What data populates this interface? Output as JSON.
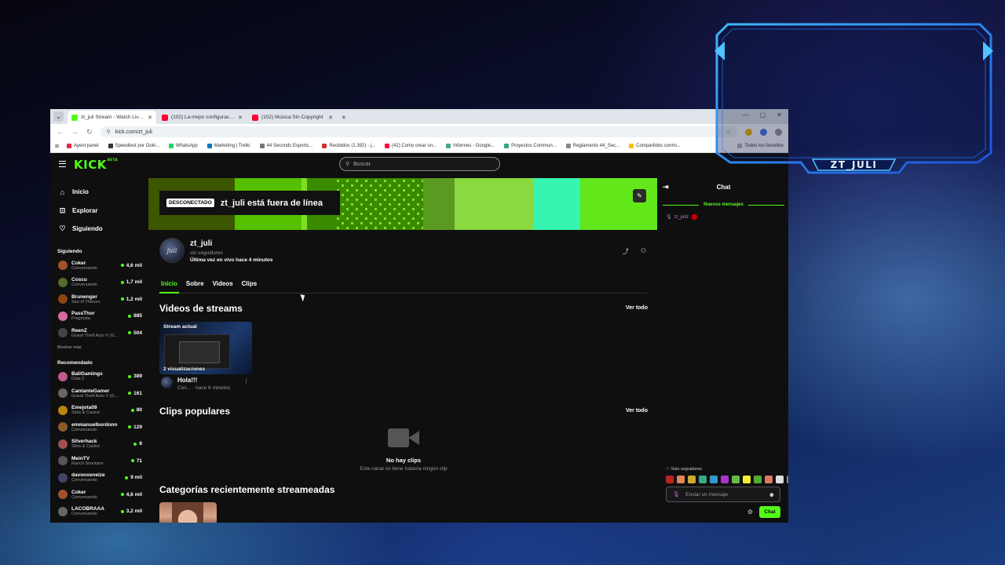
{
  "browser": {
    "tabs": [
      {
        "title": "zt_juli Stream - Watch Live on Kick",
        "icon_color": "#53fc18",
        "active": true
      },
      {
        "title": "(102) La mejor configuración de OBS",
        "icon_color": "#ff0033",
        "active": false
      },
      {
        "title": "(102) Música Sin Copyright",
        "icon_color": "#ff0033",
        "active": false
      }
    ],
    "url": "kick.com/zt_juli",
    "bookmarks": [
      "Ayent panel",
      "Speedtest por Ookl...",
      "WhatsApp",
      "Marketing | Trello",
      "44 Seconds Esports...",
      "Recibidos (1.392) - j...",
      "(42) Como crear un...",
      "Informes - Google...",
      "Proyectos Commun...",
      "Reglamento 44_Sec...",
      "Compartidos conmi..."
    ],
    "other_bookmarks": "Todos los favoritos"
  },
  "kick": {
    "logo": "KICK",
    "logo_sup": "BETA",
    "search_placeholder": "Buscar",
    "nav": [
      {
        "label": "Inicio",
        "icon": "home-icon",
        "glyph": "⌂"
      },
      {
        "label": "Explorar",
        "icon": "compass-icon",
        "glyph": "⊡"
      },
      {
        "label": "Siguiendo",
        "icon": "heart-icon",
        "glyph": "♡"
      }
    ],
    "following_title": "Siguiendo",
    "following": [
      {
        "name": "Coker",
        "category": "Conversando",
        "viewers": "4,6 mil",
        "color": "#a0522d"
      },
      {
        "name": "Coscu",
        "category": "Conversando",
        "viewers": "1,7 mil",
        "color": "#556b2f"
      },
      {
        "name": "Brunenger",
        "category": "Sea of Thieves",
        "viewers": "1,2 mil",
        "color": "#8b4513"
      },
      {
        "name": "PassThor",
        "category": "Pragmata",
        "viewers": "885",
        "color": "#d46aa0"
      },
      {
        "name": "ReenZ",
        "category": "Grand Theft Auto V (G...",
        "viewers": "504",
        "color": "#444444"
      }
    ],
    "show_more": "Mostrar más",
    "recommended_title": "Recomendado",
    "recommended": [
      {
        "name": "BaliGamings",
        "category": "Dota 2",
        "viewers": "389",
        "color": "#c05a8f"
      },
      {
        "name": "CantanteGamer",
        "category": "Grand Theft Auto V (G...",
        "viewers": "161",
        "color": "#666666"
      },
      {
        "name": "Emejota09",
        "category": "Slots & Casino",
        "viewers": "80",
        "color": "#b8860b"
      },
      {
        "name": "emmanuelbordonn",
        "category": "Conversando",
        "viewers": "129",
        "color": "#8b5a2b"
      },
      {
        "name": "Silverhack",
        "category": "Slots & Casino",
        "viewers": "8",
        "color": "#a05050"
      },
      {
        "name": "MeinTV",
        "category": "Ranch Simulator",
        "viewers": "71",
        "color": "#555555"
      },
      {
        "name": "davooxeneize",
        "category": "Conversando",
        "viewers": "9 mil",
        "color": "#444466"
      },
      {
        "name": "Coker",
        "category": "Conversando",
        "viewers": "4,6 mil",
        "color": "#a0522d"
      },
      {
        "name": "LACOBRAAA",
        "category": "Conversando",
        "viewers": "3,2 mil",
        "color": "#666666"
      }
    ],
    "banner": {
      "status_pill": "DESCONECTADO",
      "status_text": "zt_juli está fuera de línea"
    },
    "profile": {
      "name": "zt_juli",
      "followers": "sin seguidores",
      "last_live": "Última vez en vivo hace 4 minutos",
      "avatar_text": "juli"
    },
    "tabs": [
      "Inicio",
      "Sobre",
      "Videos",
      "Clips"
    ],
    "videos_section": {
      "title": "Videos de streams",
      "see_all": "Ver todo",
      "video": {
        "label": "Stream actual",
        "views": "2 visualizaciones",
        "title": "Hola!!!",
        "meta": "Con... · hace 6 minutos"
      }
    },
    "clips_section": {
      "title": "Clips populares",
      "see_all": "Ver todo",
      "empty_title": "No hay clips",
      "empty_sub": "Este canal no tiene todavía ningún clip"
    },
    "categories_title": "Categorías recientemente streameadas",
    "chat": {
      "title": "Chat",
      "new_messages": "Nuevos mensajes",
      "message_user": "zt_juliz",
      "followers_only": "♡ Solo seguidores",
      "input_placeholder": "Enviar un mensaje",
      "send_label": "Chat"
    }
  },
  "overlay": {
    "label": "ZT_JULI"
  }
}
